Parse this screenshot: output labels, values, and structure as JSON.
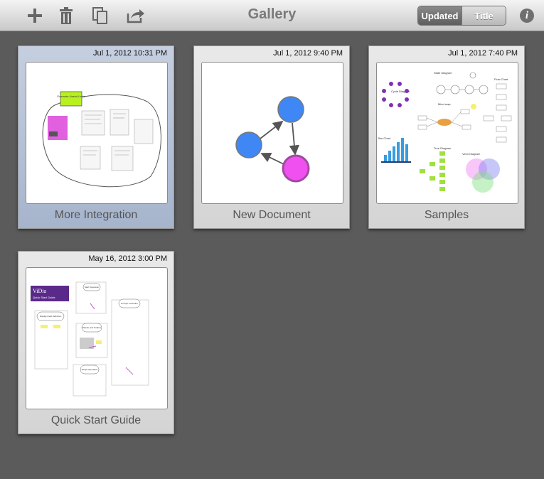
{
  "toolbar": {
    "title": "Gallery",
    "add_icon": "plus-icon",
    "delete_icon": "trash-icon",
    "duplicate_icon": "duplicate-icon",
    "share_icon": "share-icon",
    "sort_options": [
      "Updated",
      "Title"
    ],
    "sort_selected": "Updated",
    "info_label": "i"
  },
  "documents": [
    {
      "title": "More Integration",
      "date": "Jul 1, 2012 10:31 PM",
      "selected": true
    },
    {
      "title": "New Document",
      "date": "Jul 1, 2012 9:40 PM",
      "selected": false
    },
    {
      "title": "Samples",
      "date": "Jul 1, 2012 7:40 PM",
      "selected": false
    },
    {
      "title": "Quick Start Guide",
      "date": "May 16, 2012 3:00 PM",
      "selected": false
    }
  ],
  "thumb_text": {
    "integration_note": "Evernote Useful Links",
    "samples": {
      "state": "State Diagram",
      "cycle": "Cycle Diagram",
      "flow": "Flow Chart",
      "mind": "Mind map",
      "bar": "Bar Chart",
      "tree": "Tree Diagram",
      "venn": "Venn Diagram"
    },
    "guide": {
      "brand": "ViDia",
      "subtitle": "Quick Start Guide",
      "start": "Start Operation",
      "prompt": "Prompt Controller",
      "display": "Display Field Definition",
      "palette": "Palette and Toolbox",
      "shape": "Shape Operation"
    }
  },
  "colors": {
    "accent_selected": "#a6b4cc",
    "node_blue": "#3f87f5",
    "node_pink": "#f050f0",
    "background": "#5b5b5b"
  }
}
